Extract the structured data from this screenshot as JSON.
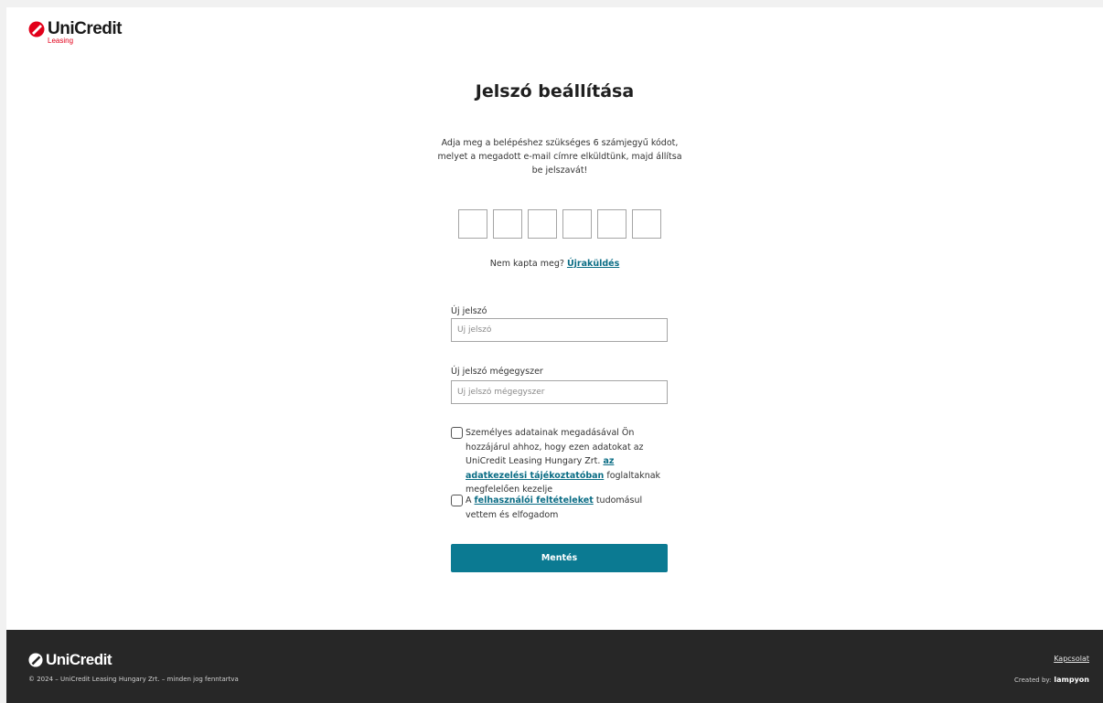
{
  "brand": {
    "name": "UniCredit",
    "subtitle": "Leasing",
    "color": "#e2001a"
  },
  "page": {
    "title": "Jelszó beállítása",
    "intro": "Adja meg a belépéshez szükséges 6 számjegyű kódot, melyet a megadott e-mail címre elküldtünk, majd állítsa be jelszavát!",
    "code_length": 6,
    "resend_prefix": "Nem kapta meg?",
    "resend_link": "Újraküldés"
  },
  "form": {
    "new_password": {
      "label": "Új jelszó",
      "placeholder": "Új jelszó"
    },
    "confirm_password": {
      "label": "Új jelszó mégegyszer",
      "placeholder": "Új jelszó mégegyszer"
    },
    "consent": {
      "text_before": "Személyes adatainak megadásával Ön hozzájárul ahhoz, hogy ezen adatokat az UniCredit Leasing Hungary Zrt.",
      "link": "az adatkezelési tájékoztatóban",
      "text_after": "foglaltaknak megfelelően kezelje"
    },
    "terms": {
      "text_before": "A",
      "link": "felhasználói feltételeket",
      "text_after": "tudomásul vettem és elfogadom"
    },
    "submit_label": "Mentés",
    "accent_color": "#0b7a92"
  },
  "footer": {
    "brand": "UniCredit",
    "copyright": "© 2024 – UniCredit Leasing Hungary Zrt. – minden jog fenntartva",
    "contact_link": "Kapcsolat",
    "created_by_label": "Created by:",
    "created_by_name": "lampyon"
  }
}
